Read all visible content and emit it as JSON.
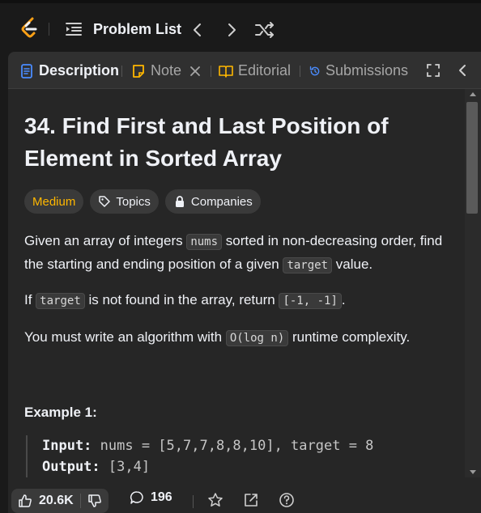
{
  "topbar": {
    "problem_list_label": "Problem List"
  },
  "tabs": [
    {
      "label": "Description",
      "icon": "description-icon",
      "active": true
    },
    {
      "label": "Note",
      "icon": "note-icon",
      "closable": true
    },
    {
      "label": "Editorial",
      "icon": "book-icon"
    },
    {
      "label": "Submissions",
      "icon": "history-icon"
    }
  ],
  "problem": {
    "title": "34. Find First and Last Position of Element in Sorted Array",
    "difficulty": "Medium",
    "topics_label": "Topics",
    "companies_label": "Companies",
    "p1_a": "Given an array of integers ",
    "p1_code1": "nums",
    "p1_b": " sorted in non-decreasing order, find the starting and ending position of a given ",
    "p1_code2": "target",
    "p1_c": " value.",
    "p2_a": "If ",
    "p2_code1": "target",
    "p2_b": " is not found in the array, return ",
    "p2_code2": "[-1, -1]",
    "p2_c": ".",
    "p3_a": "You must write an algorithm with ",
    "p3_code": "O(log n)",
    "p3_b": " runtime complexity.",
    "example_title": "Example 1:",
    "input_label": "Input:",
    "input_value": " nums = [5,7,7,8,8,10], target = 8",
    "output_label": "Output:",
    "output_value": " [3,4]"
  },
  "footer": {
    "likes": "20.6K",
    "comments": "196"
  },
  "colors": {
    "difficulty_medium": "#ffb700",
    "background": "#1a1a1a",
    "panel": "#262626"
  }
}
